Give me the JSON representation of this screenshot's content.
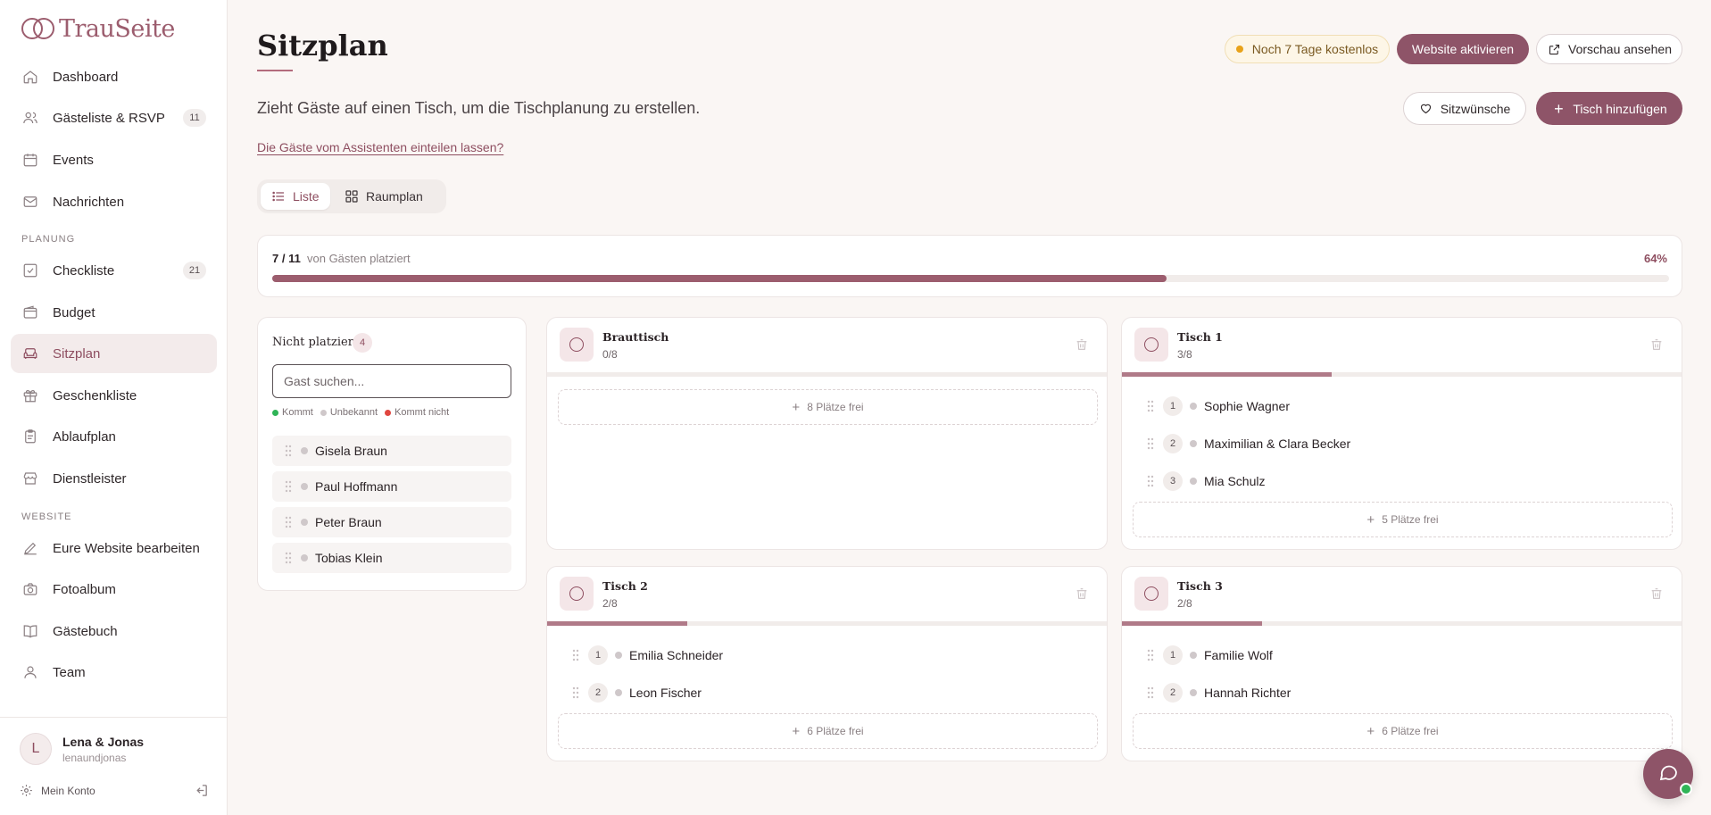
{
  "brand": {
    "name": "TrauSeite"
  },
  "nav": {
    "main": [
      {
        "label": "Dashboard",
        "icon": "home-icon"
      },
      {
        "label": "Gästeliste & RSVP",
        "icon": "users-icon",
        "badge": "11"
      },
      {
        "label": "Events",
        "icon": "calendar-icon"
      },
      {
        "label": "Nachrichten",
        "icon": "mail-icon"
      }
    ],
    "section_planung": "PLANUNG",
    "planung": [
      {
        "label": "Checkliste",
        "icon": "checklist-icon",
        "badge": "21"
      },
      {
        "label": "Budget",
        "icon": "wallet-icon"
      },
      {
        "label": "Sitzplan",
        "icon": "sofa-icon",
        "active": true
      },
      {
        "label": "Geschenkliste",
        "icon": "gift-icon"
      },
      {
        "label": "Ablaufplan",
        "icon": "clipboard-icon"
      },
      {
        "label": "Dienstleister",
        "icon": "store-icon"
      }
    ],
    "section_website": "WEBSITE",
    "website": [
      {
        "label": "Eure Website bearbeiten",
        "icon": "pen-icon"
      },
      {
        "label": "Fotoalbum",
        "icon": "camera-icon"
      },
      {
        "label": "Gästebuch",
        "icon": "book-icon"
      },
      {
        "label": "Team",
        "icon": "user-icon"
      }
    ]
  },
  "user": {
    "initial": "L",
    "name": "Lena & Jonas",
    "handle": "lenaundjonas",
    "account_label": "Mein Konto"
  },
  "header": {
    "title": "Sitzplan",
    "subtitle": "Zieht Gäste auf einen Tisch, um die Tischplanung zu erstellen.",
    "assistant_link": "Die Gäste vom Assistenten einteilen lassen?",
    "trial": "Noch 7 Tage kostenlos",
    "activate": "Website aktivieren",
    "preview": "Vorschau ansehen",
    "wishes": "Sitzwünsche",
    "add_table": "Tisch hinzufügen"
  },
  "view_toggle": {
    "list": "Liste",
    "room": "Raumplan",
    "selected": "Liste"
  },
  "progress": {
    "count": "7 / 11",
    "label": "von Gästen platziert",
    "percent_text": "64%",
    "fraction": 0.64
  },
  "unplaced": {
    "title": "Nicht platziert",
    "count": "4",
    "search_placeholder": "Gast suchen...",
    "legend": [
      {
        "label": "Kommt",
        "color": "#2fb457"
      },
      {
        "label": "Unbekannt",
        "color": "#cfc8ca"
      },
      {
        "label": "Kommt nicht",
        "color": "#e0463f"
      }
    ],
    "guests": [
      "Gisela Braun",
      "Paul Hoffmann",
      "Peter Braun",
      "Tobias Klein"
    ]
  },
  "tables": [
    {
      "name": "Brauttisch",
      "count": "0/8",
      "fill": 0.0,
      "guests": [],
      "free": "8 Plätze frei"
    },
    {
      "name": "Tisch 1",
      "count": "3/8",
      "fill": 0.375,
      "guests": [
        "Sophie Wagner",
        "Maximilian & Clara Becker",
        "Mia Schulz"
      ],
      "free": "5 Plätze frei"
    },
    {
      "name": "Tisch 2",
      "count": "2/8",
      "fill": 0.25,
      "guests": [
        "Emilia Schneider",
        "Leon Fischer"
      ],
      "free": "6 Plätze frei"
    },
    {
      "name": "Tisch 3",
      "count": "2/8",
      "fill": 0.25,
      "guests": [
        "Familie Wolf",
        "Hannah Richter"
      ],
      "free": "6 Plätze frei"
    }
  ],
  "colors": {
    "accent": "#8e5468",
    "accent_text": "#8e4e60",
    "background": "#faf6f4"
  }
}
